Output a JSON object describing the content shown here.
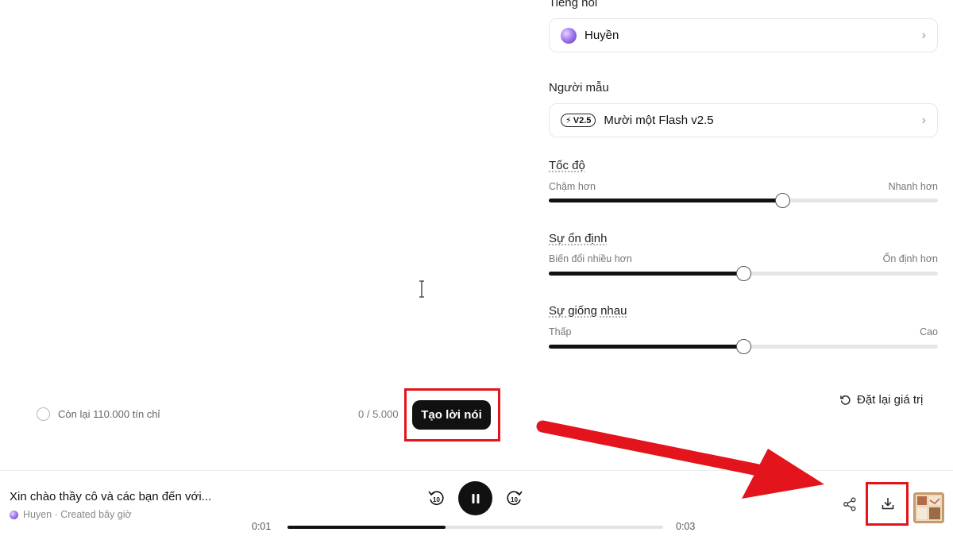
{
  "settings": {
    "voice": {
      "label": "Tiếng nói",
      "value": "Huyền",
      "chevron_icon": "chevron-right-icon"
    },
    "model": {
      "label": "Người mẫu",
      "badge": "V2.5",
      "value": "Mười một Flash v2.5",
      "chevron_icon": "chevron-right-icon"
    },
    "speed": {
      "label": "Tốc độ",
      "min_hint": "Chậm hơn",
      "max_hint": "Nhanh hơn",
      "level": 0.6
    },
    "stability": {
      "label": "Sự ổn định",
      "min_hint": "Biến đổi nhiều hơn",
      "max_hint": "Ổn định hơn",
      "level": 0.5
    },
    "similarity": {
      "label": "Sự giống nhau",
      "min_hint": "Thấp",
      "max_hint": "Cao",
      "level": 0.5
    },
    "reset_label": "Đặt lại giá trị"
  },
  "editor": {
    "credits_text": "Còn lại 110.000 tín chỉ",
    "char_count": "0 / 5.000",
    "generate_label": "Tạo lời nói"
  },
  "player": {
    "title": "Xin chào thầy cô và các bạn đến với...",
    "meta": "Huyen · Created bây giờ",
    "current_time": "0:01",
    "total_time": "0:03",
    "progress": 0.42,
    "rewind_label": "10",
    "forward_label": "10"
  },
  "colors": {
    "highlight": "#e3141b",
    "accent": "#111111"
  }
}
